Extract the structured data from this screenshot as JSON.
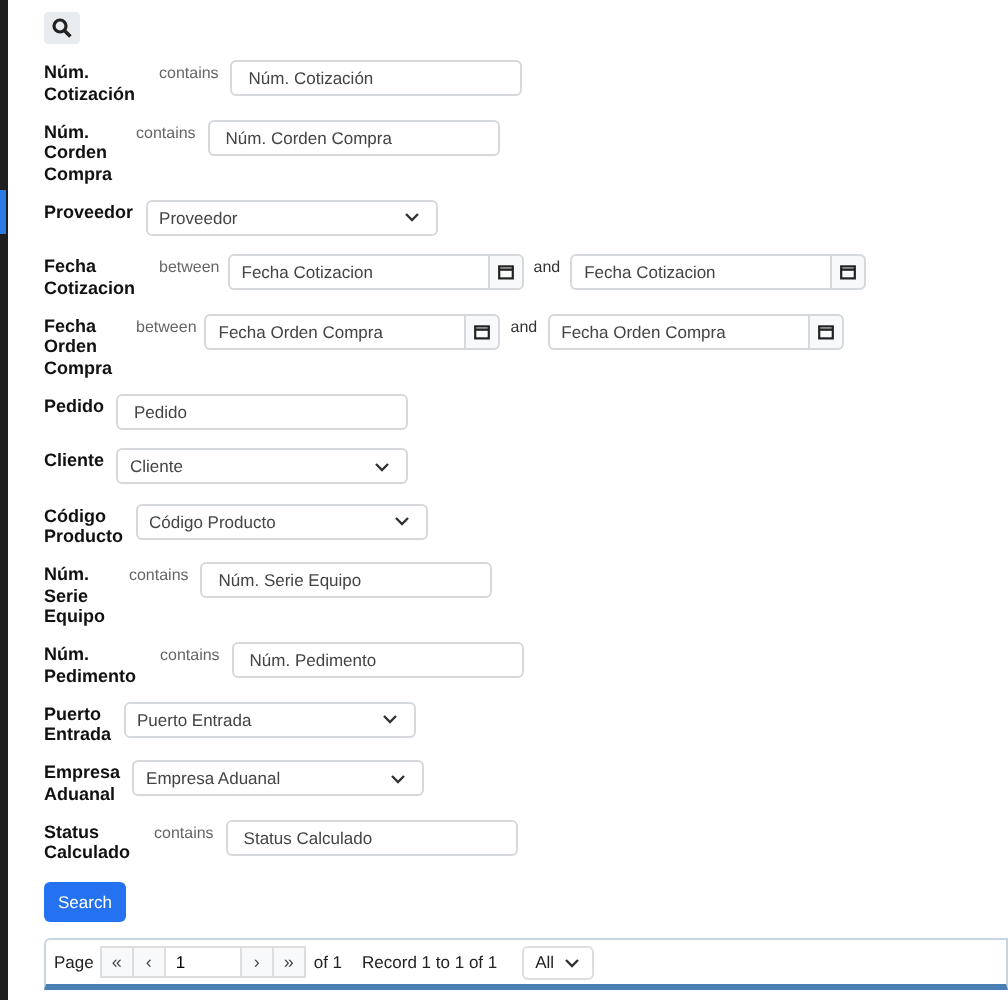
{
  "filters": [
    {
      "kind": "contains",
      "label": "Núm. Cotización",
      "operator": "contains",
      "placeholder": "Núm. Cotización"
    },
    {
      "kind": "contains",
      "label": "Núm. Corden Compra",
      "operator": "contains",
      "placeholder": "Núm. Corden Compra"
    },
    {
      "kind": "select",
      "label": "Proveedor",
      "placeholder": "Proveedor"
    },
    {
      "kind": "between",
      "label": "Fecha Cotizacion",
      "operator": "between",
      "placeholder": "Fecha Cotizacion",
      "joiner": "and",
      "placeholder_end": "Fecha Cotizacion"
    },
    {
      "kind": "between",
      "label": "Fecha Orden Compra",
      "operator": "between",
      "placeholder": "Fecha Orden Compra",
      "joiner": "and",
      "placeholder_end": "Fecha Orden Compra"
    },
    {
      "kind": "text",
      "label": "Pedido",
      "placeholder": "Pedido"
    },
    {
      "kind": "select",
      "label": "Cliente",
      "placeholder": "Cliente"
    },
    {
      "kind": "select",
      "label": "Código Producto",
      "placeholder": "Código Producto"
    },
    {
      "kind": "contains",
      "label": "Núm. Serie Equipo",
      "operator": "contains",
      "placeholder": "Núm. Serie Equipo"
    },
    {
      "kind": "contains",
      "label": "Núm. Pedimento",
      "operator": "contains",
      "placeholder": "Núm. Pedimento"
    },
    {
      "kind": "select",
      "label": "Puerto Entrada",
      "placeholder": "Puerto Entrada"
    },
    {
      "kind": "select",
      "label": "Empresa Aduanal",
      "placeholder": "Empresa Aduanal"
    },
    {
      "kind": "contains",
      "label": "Status Calculado",
      "operator": "contains",
      "placeholder": "Status Calculado"
    }
  ],
  "search_button": "Search",
  "pager": {
    "label": "Page",
    "first": "«",
    "prev": "‹",
    "page": "1",
    "next": "›",
    "last": "»",
    "of": "of 1",
    "record": "Record 1 to 1 of 1",
    "size": "All"
  }
}
